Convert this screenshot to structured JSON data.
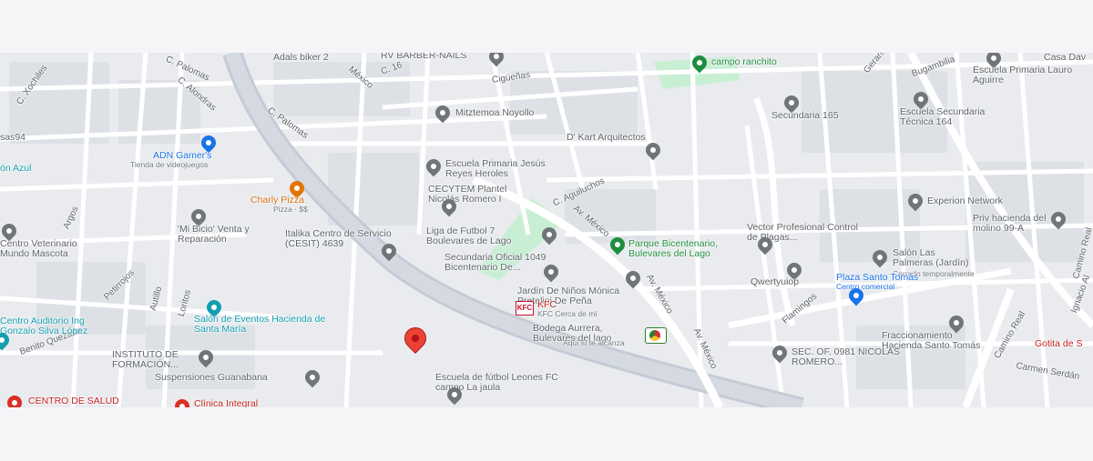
{
  "colors": {
    "park": "#c8efd4",
    "road_major": "#c5cbd6",
    "road_minor": "#ffffff",
    "block": "#dde1e6"
  },
  "pois": [
    {
      "label": "Adals biker 2",
      "kind": "gray"
    },
    {
      "label": "RV BARBER-NAILS",
      "kind": "gray"
    },
    {
      "label": "campo ranchito",
      "kind": "green"
    },
    {
      "label": "Casa Dav",
      "kind": "gray"
    },
    {
      "label": "Escuela Primaria Lauro Aguirre",
      "kind": "gray"
    },
    {
      "label": "Mitztemoa Noyollo",
      "kind": "gray"
    },
    {
      "label": "Secundaria 165",
      "kind": "gray"
    },
    {
      "label": "Escuela Secundaria Técnica 164",
      "kind": "gray"
    },
    {
      "label": "ADN Gamer's",
      "sub": "Tienda de videojuegos",
      "kind": "blue"
    },
    {
      "label": "D' Kart Arquitectos",
      "kind": "gray"
    },
    {
      "label": "Escuela Primaria Jesús Reyes Heroles",
      "kind": "gray"
    },
    {
      "label": "Charly Pizza",
      "sub": "Pizza · $$",
      "kind": "orange"
    },
    {
      "label": "CECYTEM Plantel Nicolás Romero I",
      "kind": "gray"
    },
    {
      "label": "Experion Network",
      "kind": "gray"
    },
    {
      "label": "Priv hacienda del molino 99-A",
      "kind": "gray"
    },
    {
      "label": "'Mi Bicio' Venta y Reparación",
      "kind": "gray"
    },
    {
      "label": "Italika Centro de Servicio (CESIT) 4639",
      "kind": "gray"
    },
    {
      "label": "Liga de Futbol 7 Boulevares de Lago",
      "kind": "gray"
    },
    {
      "label": "Parque Bicentenario, Bulevares del Lago",
      "kind": "green"
    },
    {
      "label": "Vector Profesional Control de Plagas...",
      "kind": "gray"
    },
    {
      "label": "Salón Las Palmeras (Jardín)",
      "sub": "Cerrado temporalmente",
      "kind": "gray"
    },
    {
      "label": "Centro Veterinario Mundo Mascota",
      "kind": "gray"
    },
    {
      "label": "Secundaria Oficial 1049 Bicentenario De...",
      "kind": "gray"
    },
    {
      "label": "Qwertyuiop",
      "kind": "gray"
    },
    {
      "label": "Plaza Santo Tomás",
      "sub": "Centro comercial",
      "kind": "blue"
    },
    {
      "label": "Jardín De Niños Mónica Pretelini De Peña",
      "kind": "gray"
    },
    {
      "label": "KFC",
      "sub": "KFC Cerca de mí",
      "kind": "red"
    },
    {
      "label": "Salón de Eventos Hacienda de Santa María",
      "kind": "teal"
    },
    {
      "label": "Centro Auditorio Ing Gonzalo Silva López",
      "kind": "teal"
    },
    {
      "label": "Bodega Aurrera, Bulevares del lago",
      "sub": "Aquí sí te alcanza",
      "kind": "gray"
    },
    {
      "label": "Fraccionamiento Hacienda Santo Tomás",
      "kind": "gray"
    },
    {
      "label": "INSTITUTO DE FORMACIÓN...",
      "kind": "gray"
    },
    {
      "label": "SEC. OF. 0981 NICOLÁS ROMERO...",
      "kind": "gray"
    },
    {
      "label": "Suspensiones Guanabana",
      "kind": "gray"
    },
    {
      "label": "Escuela de fútbol Leones FC campo La jaula",
      "kind": "gray"
    },
    {
      "label": "CENTRO DE SALUD",
      "kind": "red"
    },
    {
      "label": "Clínica Integral",
      "kind": "red"
    },
    {
      "label": "Gotita de S",
      "kind": "red"
    }
  ],
  "streets": [
    "C. Palomas",
    "C. Xochiles",
    "C. Alondras",
    "México",
    "C. 16",
    "Cigüeñas",
    "Gerant",
    "Bugambilia",
    "C. Palomas",
    "C. Aguiluchos",
    "Av. México",
    "Av. México",
    "Av. México",
    "Argos",
    "Petirrojos",
    "Autillo",
    "Loritos",
    "Flamingos",
    "Camino Real",
    "Camino Real",
    "Carmen Serdán",
    "Benito Quezada",
    "Ignacio Al"
  ],
  "fragments": [
    "sas94",
    "ón Azul"
  ]
}
